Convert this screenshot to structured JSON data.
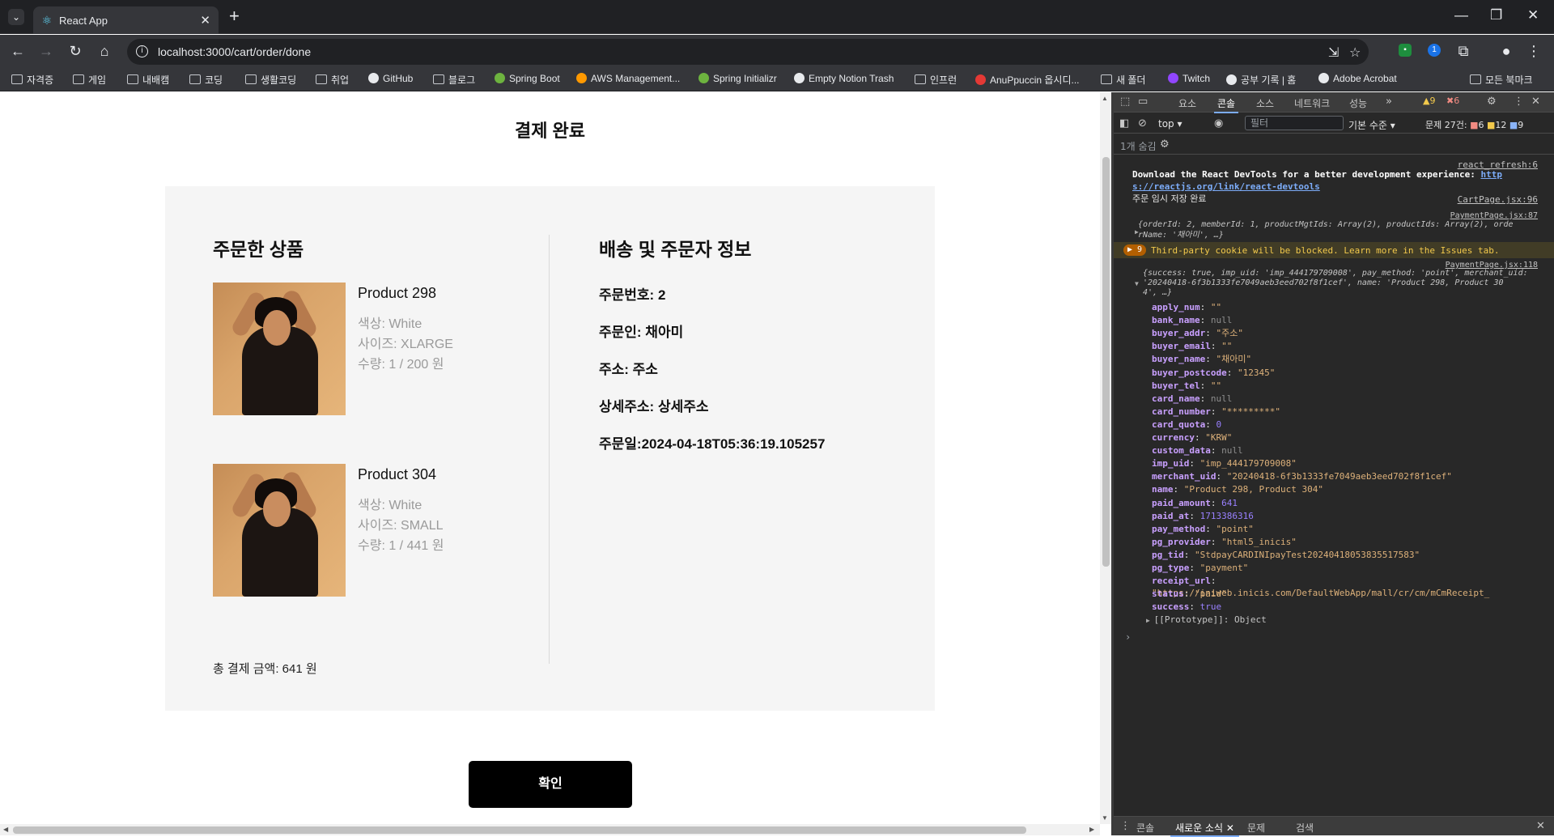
{
  "browser": {
    "tab_title": "React App",
    "url": "localhost:3000/cart/order/done",
    "bookmarks": [
      {
        "label": "자격증",
        "icon": "folder-icon"
      },
      {
        "label": "게임",
        "icon": "folder-icon"
      },
      {
        "label": "내배캠",
        "icon": "folder-icon"
      },
      {
        "label": "코딩",
        "icon": "folder-icon"
      },
      {
        "label": "생활코딩",
        "icon": "folder-icon"
      },
      {
        "label": "취업",
        "icon": "folder-icon"
      },
      {
        "label": "GitHub",
        "icon": "github-icon"
      },
      {
        "label": "블로그",
        "icon": "folder-icon"
      },
      {
        "label": "Spring Boot",
        "icon": "spring-icon"
      },
      {
        "label": "AWS Management...",
        "icon": "aws-icon"
      },
      {
        "label": "Spring Initializr",
        "icon": "spring-icon"
      },
      {
        "label": "Empty Notion Trash",
        "icon": "notion-icon"
      },
      {
        "label": "인프런",
        "icon": "folder-icon"
      },
      {
        "label": "AnuPpuccin 옵시디...",
        "icon": "obsidian-icon"
      },
      {
        "label": "새 폴더",
        "icon": "folder-icon"
      },
      {
        "label": "Twitch",
        "icon": "twitch-icon"
      },
      {
        "label": "공부 기록 | 홈",
        "icon": "notion-icon"
      },
      {
        "label": "Adobe Acrobat",
        "icon": "acrobat-icon"
      }
    ],
    "all_bookmarks": "모든 북마크"
  },
  "page": {
    "title": "결제 완료",
    "ordered_title": "주문한 상품",
    "delivery_title": "배송 및 주문자 정보",
    "products": [
      {
        "name": "Product 298",
        "color": "색상: White",
        "size": "사이즈: XLARGE",
        "qty": "수량: 1 / 200 원"
      },
      {
        "name": "Product 304",
        "color": "색상: White",
        "size": "사이즈: SMALL",
        "qty": "수량: 1 / 441 원"
      }
    ],
    "info": {
      "order_no": "주문번호: 2",
      "orderer": "주문인: 채아미",
      "address": "주소: 주소",
      "detail_address": "상세주소: 상세주소",
      "order_date": "주문일:2024-04-18T05:36:19.105257"
    },
    "total": "총 결제 금액: 641 원",
    "confirm_label": "확인"
  },
  "devtools": {
    "tabs": [
      "요소",
      "콘솔",
      "소스",
      "네트워크",
      "성능"
    ],
    "active_tab": "콘솔",
    "warn_count": "9",
    "error_count": "6",
    "context": "top",
    "filter_placeholder": "필터",
    "level": "기본 수준",
    "issues_label": "문제 27건:",
    "issues_err": "6",
    "issues_warn": "12",
    "issues_info": "9",
    "hidden": "1개 숨김",
    "console": {
      "src1": "react_refresh:6",
      "devtools_msg_a": "Download the React DevTools for a better development experience: ",
      "devtools_link_a": "http",
      "devtools_link_b": "s://reactjs.org/link/react-devtools",
      "src2": "CartPage.jsx:96",
      "msg2": "주문 임시 저장 완료",
      "src3": "PaymentPage.jsx:87",
      "obj3a": "{orderId: 2, memberId: 1, productMgtIds: Array(2), productIds: Array(2), orde",
      "obj3b": "rName: '채아미', …}",
      "warn_badge": "9",
      "warn_msg": "Third-party cookie will be blocked. Learn more in the Issues tab.",
      "src4": "PaymentPage.jsx:118",
      "obj4a": "{success: true, imp_uid: 'imp_444179709008', pay_method: 'point', merchant_uid:",
      "obj4b": "'20240418-6f3b1333fe7049aeb3eed702f8f1cef', name: 'Product 298, Product 30",
      "obj4c": "4', …}",
      "props": [
        {
          "k": "apply_num",
          "v": "\"\"",
          "t": "str"
        },
        {
          "k": "bank_name",
          "v": "null",
          "t": "null"
        },
        {
          "k": "buyer_addr",
          "v": "\"주소\"",
          "t": "str"
        },
        {
          "k": "buyer_email",
          "v": "\"\"",
          "t": "str"
        },
        {
          "k": "buyer_name",
          "v": "\"채아미\"",
          "t": "str"
        },
        {
          "k": "buyer_postcode",
          "v": "\"12345\"",
          "t": "str"
        },
        {
          "k": "buyer_tel",
          "v": "\"\"",
          "t": "str"
        },
        {
          "k": "card_name",
          "v": "null",
          "t": "null"
        },
        {
          "k": "card_number",
          "v": "\"*********\"",
          "t": "str"
        },
        {
          "k": "card_quota",
          "v": "0",
          "t": "num"
        },
        {
          "k": "currency",
          "v": "\"KRW\"",
          "t": "str"
        },
        {
          "k": "custom_data",
          "v": "null",
          "t": "null"
        },
        {
          "k": "imp_uid",
          "v": "\"imp_444179709008\"",
          "t": "str"
        },
        {
          "k": "merchant_uid",
          "v": "\"20240418-6f3b1333fe7049aeb3eed702f8f1cef\"",
          "t": "str"
        },
        {
          "k": "name",
          "v": "\"Product 298, Product 304\"",
          "t": "str"
        },
        {
          "k": "paid_amount",
          "v": "641",
          "t": "num"
        },
        {
          "k": "paid_at",
          "v": "1713386316",
          "t": "num"
        },
        {
          "k": "pay_method",
          "v": "\"point\"",
          "t": "str"
        },
        {
          "k": "pg_provider",
          "v": "\"html5_inicis\"",
          "t": "str"
        },
        {
          "k": "pg_tid",
          "v": "\"StdpayCARDINIpayTest20240418053835517583\"",
          "t": "str"
        },
        {
          "k": "pg_type",
          "v": "\"payment\"",
          "t": "str"
        },
        {
          "k": "receipt_url",
          "v": "\"https://iniweb.inicis.com/DefaultWebApp/mall/cr/cm/mCmReceipt_",
          "t": "str"
        },
        {
          "k": "status",
          "v": "\"paid\"",
          "t": "str"
        },
        {
          "k": "success",
          "v": "true",
          "t": "num"
        }
      ],
      "prototype": "[[Prototype]]: Object"
    },
    "drawer_tabs": [
      "콘솔",
      "새로운 소식",
      "문제",
      "검색"
    ],
    "drawer_active": "새로운 소식"
  }
}
